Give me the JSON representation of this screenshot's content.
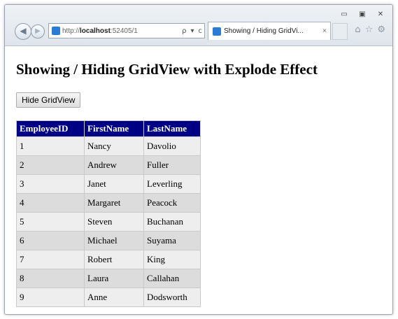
{
  "browser": {
    "window_controls": {
      "minimize": "▭",
      "maximize": "▣",
      "close": "✕"
    },
    "url_prefix": "http://",
    "url_host": "localhost",
    "url_rest": ":52405/1",
    "search_glyph": "ρ",
    "dropdown_glyph": "▾",
    "refresh_glyph": "c",
    "tab_title": "Showing / Hiding GridVi...",
    "tab_close": "×",
    "tools": {
      "home": "⌂",
      "favorites": "☆",
      "settings": "⚙"
    }
  },
  "page": {
    "heading": "Showing / Hiding GridView with Explode Effect",
    "toggle_button_label": "Hide GridView"
  },
  "grid": {
    "columns": [
      "EmployeeID",
      "FirstName",
      "LastName"
    ],
    "rows": [
      [
        "1",
        "Nancy",
        "Davolio"
      ],
      [
        "2",
        "Andrew",
        "Fuller"
      ],
      [
        "3",
        "Janet",
        "Leverling"
      ],
      [
        "4",
        "Margaret",
        "Peacock"
      ],
      [
        "5",
        "Steven",
        "Buchanan"
      ],
      [
        "6",
        "Michael",
        "Suyama"
      ],
      [
        "7",
        "Robert",
        "King"
      ],
      [
        "8",
        "Laura",
        "Callahan"
      ],
      [
        "9",
        "Anne",
        "Dodsworth"
      ]
    ]
  },
  "colors": {
    "header_bg": "#000084",
    "row_odd": "#eeeeee",
    "row_even": "#dcdcdc"
  }
}
